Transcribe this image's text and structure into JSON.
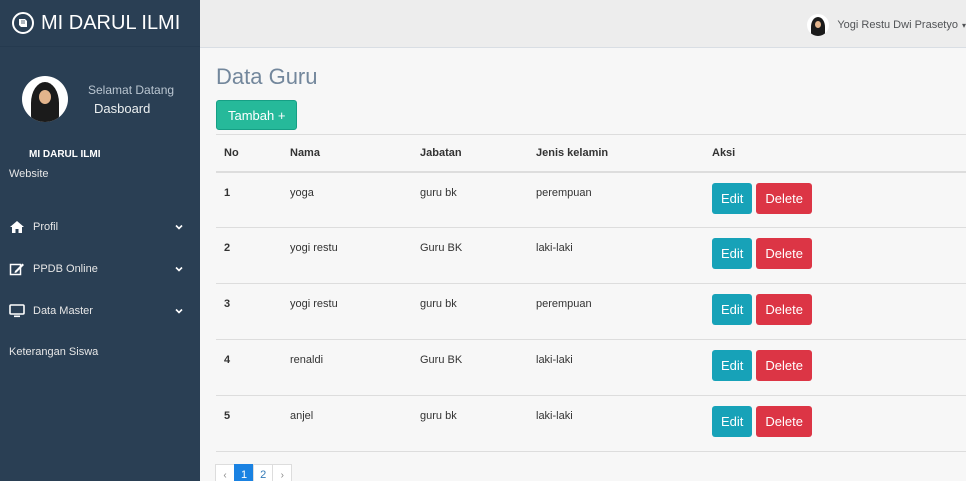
{
  "brand": {
    "title": "MI DARUL ILMI",
    "icon": "book-icon"
  },
  "profile": {
    "welcome": "Selamat Datang",
    "name": "Dasboard"
  },
  "sidebar": {
    "section_title": "MI DARUL ILMI",
    "items": [
      {
        "label": "Website",
        "icon": "",
        "has_chevron": false
      },
      {
        "label": "Profil",
        "icon": "home-icon",
        "has_chevron": true
      },
      {
        "label": "PPDB Online",
        "icon": "edit-icon",
        "has_chevron": true
      },
      {
        "label": "Data Master",
        "icon": "desktop-icon",
        "has_chevron": true
      },
      {
        "label": "Keterangan Siswa",
        "icon": "",
        "has_chevron": false
      }
    ]
  },
  "topbar": {
    "user_name": "Yogi Restu Dwi Prasetyo"
  },
  "main": {
    "title": "Data Guru",
    "add_button": "Tambah +",
    "table": {
      "headers": [
        "No",
        "Nama",
        "Jabatan",
        "Jenis kelamin",
        "Aksi"
      ],
      "rows": [
        {
          "no": "1",
          "nama": "yoga",
          "jabatan": "guru bk",
          "jk": "perempuan"
        },
        {
          "no": "2",
          "nama": "yogi restu",
          "jabatan": "Guru BK",
          "jk": "laki-laki"
        },
        {
          "no": "3",
          "nama": "yogi restu",
          "jabatan": "guru bk",
          "jk": "perempuan"
        },
        {
          "no": "4",
          "nama": "renaldi",
          "jabatan": "Guru BK",
          "jk": "laki-laki"
        },
        {
          "no": "5",
          "nama": "anjel",
          "jabatan": "guru bk",
          "jk": "laki-laki"
        }
      ],
      "edit_label": "Edit",
      "delete_label": "Delete"
    },
    "pagination": {
      "prev": "‹",
      "pages": [
        "1",
        "2"
      ],
      "active": "1",
      "next": "›"
    }
  },
  "colors": {
    "sidebar": "#2a3f54",
    "accent": "#26b99a",
    "edit": "#17a2b8",
    "delete": "#dc3545",
    "page_active": "#1a82e2"
  }
}
